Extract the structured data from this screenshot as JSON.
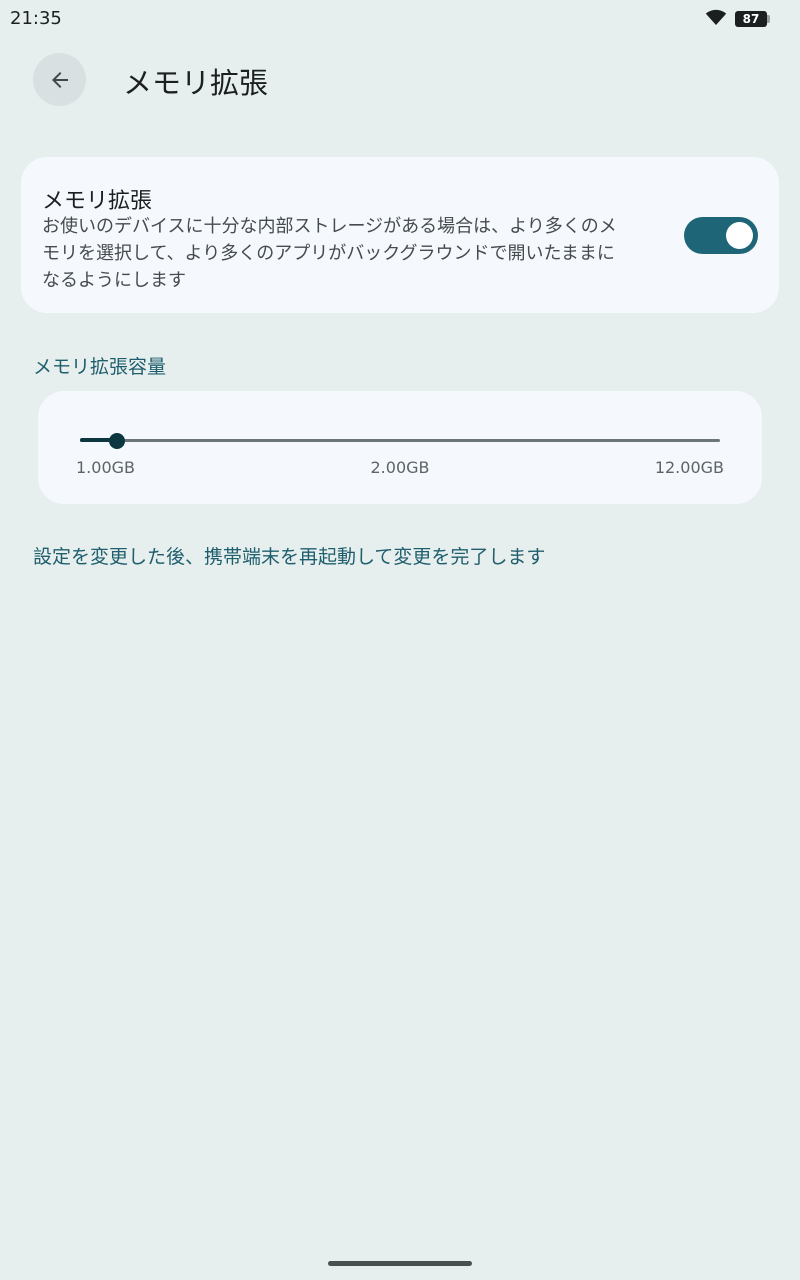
{
  "status_bar": {
    "time": "21:35",
    "battery": "87",
    "wifi_icon": "wifi-icon"
  },
  "app_bar": {
    "back_icon": "arrow-back-icon",
    "title": "メモリ拡張"
  },
  "toggle_card": {
    "title": "メモリ拡張",
    "summary": "お使いのデバイスに十分な内部ストレージがある場合は、より多くのメモリを選択して、より多くのアプリがバックグラウンドで開いたままになるようにします",
    "enabled": true,
    "accent": "#1e6677"
  },
  "capacity": {
    "section_title": "メモリ拡張容量",
    "min_label": "1.00GB",
    "mid_label": "2.00GB",
    "max_label": "12.00GB",
    "selected_index": 0,
    "step_count": 12
  },
  "footer_note": "設定を変更した後、携帯端末を再起動して変更を完了します"
}
